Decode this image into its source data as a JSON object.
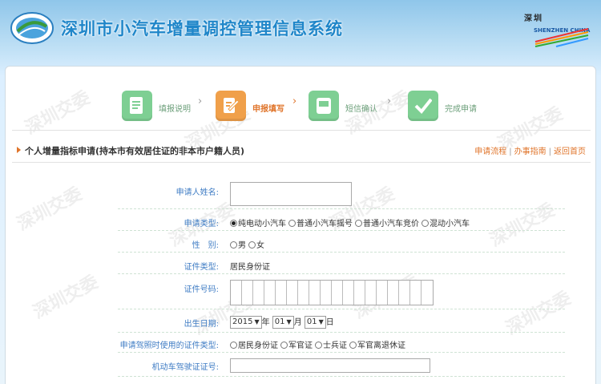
{
  "header": {
    "site_title": "深圳市小汽车增量调控管理信息系统",
    "brand_cn": "深圳",
    "brand_en": "SHENZHEN CHINA"
  },
  "steps": [
    {
      "label": "填报说明",
      "icon": "document-icon",
      "state": "done"
    },
    {
      "label": "申报填写",
      "icon": "edit-icon",
      "state": "active"
    },
    {
      "label": "短信确认",
      "icon": "message-icon",
      "state": "pending"
    },
    {
      "label": "完成申请",
      "icon": "check-icon",
      "state": "pending"
    }
  ],
  "section": {
    "title": "个人增量指标申请(持本市有效居住证的非本市户籍人员)"
  },
  "links": {
    "flow": "申请流程",
    "guide": "办事指南",
    "home": "返回首页"
  },
  "form": {
    "name_label": "申请人姓名:",
    "name_value": "",
    "type_label": "申请类型:",
    "type_options": [
      "纯电动小汽车",
      "普通小汽车摇号",
      "普通小汽车竞价",
      "混动小汽车"
    ],
    "type_selected": 0,
    "gender_label": "性　别:",
    "gender_options": [
      "男",
      "女"
    ],
    "cert_type_label": "证件类型:",
    "cert_type_value": "居民身份证",
    "cert_no_label": "证件号码:",
    "birth_label": "出生日期:",
    "birth_year": "2015",
    "birth_year_unit": "年",
    "birth_month": "01",
    "birth_month_unit": "月",
    "birth_day": "01",
    "birth_day_unit": "日",
    "license_cert_label": "申请驾照时使用的证件类型:",
    "license_cert_options": [
      "居民身份证",
      "军官证",
      "士兵证",
      "军官离退休证"
    ],
    "license_no_label": "机动车驾驶证证号:"
  },
  "watermark": "深圳交委",
  "colors": {
    "accent_orange": "#e0752b",
    "label_blue": "#3f7cc4",
    "step_green": "#7ecf93"
  }
}
